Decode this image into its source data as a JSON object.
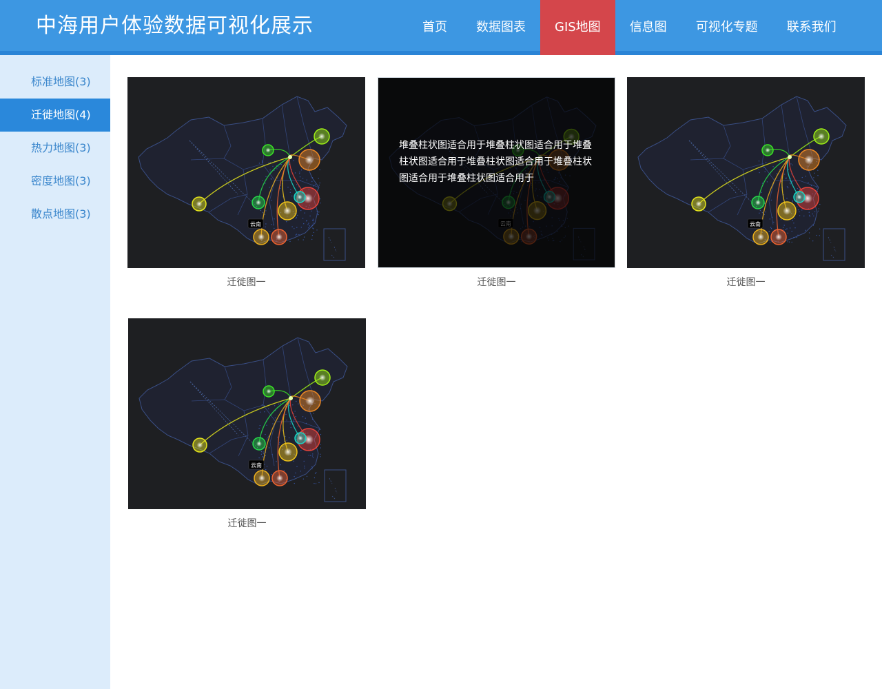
{
  "header": {
    "title": "中海用户体验数据可视化展示",
    "nav": [
      {
        "label": "首页",
        "active": false
      },
      {
        "label": "数据图表",
        "active": false
      },
      {
        "label": "GIS地图",
        "active": true
      },
      {
        "label": "信息图",
        "active": false
      },
      {
        "label": "可视化专题",
        "active": false
      },
      {
        "label": "联系我们",
        "active": false
      }
    ]
  },
  "sidebar": {
    "items": [
      {
        "label": "标准地图(3)",
        "active": false
      },
      {
        "label": "迁徙地图(4)",
        "active": true
      },
      {
        "label": "热力地图(3)",
        "active": false
      },
      {
        "label": "密度地图(3)",
        "active": false
      },
      {
        "label": "散点地图(3)",
        "active": false
      }
    ]
  },
  "gallery": {
    "cards": [
      {
        "caption": "迁徙图一",
        "hover": false
      },
      {
        "caption": "迁徙图一",
        "hover": true,
        "overlay_text": "堆叠柱状图适合用于堆叠柱状图适合用于堆叠柱状图适合用于堆叠柱状图适合用于堆叠柱状图适合用于堆叠柱状图适合用于"
      },
      {
        "caption": "迁徙图一",
        "hover": false
      },
      {
        "caption": "迁徙图一",
        "hover": false
      }
    ],
    "map_label": "云南"
  },
  "colors": {
    "header_bg": "#3d97e2",
    "active_nav": "#d4464b",
    "sidebar_bg": "#dcecfb",
    "sidebar_active": "#2a88db",
    "map_bg": "#1e1f22"
  }
}
